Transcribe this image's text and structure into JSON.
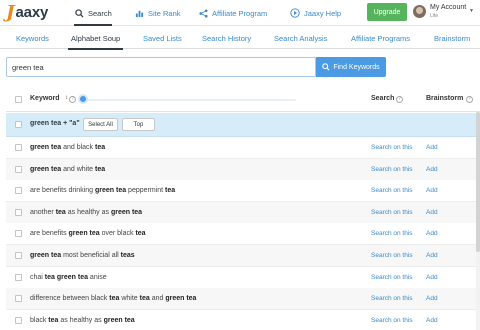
{
  "header": {
    "logo_letter": "J",
    "logo_rest": "aaxy",
    "nav": [
      {
        "label": "Search",
        "icon": "search-icon"
      },
      {
        "label": "Site Rank",
        "icon": "bar-chart-icon"
      },
      {
        "label": "Affiliate Program",
        "icon": "share-icon"
      },
      {
        "label": "Jaaxy Help",
        "icon": "play-icon"
      }
    ],
    "upgrade_label": "Upgrade",
    "account_label": "My Account",
    "account_sub": "Lite"
  },
  "tabs": [
    "Keywords",
    "Alphabet Soup",
    "Saved Lists",
    "Search History",
    "Search Analysis",
    "Affiliate Programs",
    "Brainstorm"
  ],
  "active_tab": "Alphabet Soup",
  "search": {
    "value": "green tea",
    "button_label": "Find Keywords"
  },
  "table": {
    "col_keyword": "Keyword",
    "sort_indicator": "↕",
    "col_search": "Search",
    "col_brainstorm": "Brainstorm",
    "slider_value_label": "a",
    "seed_row": {
      "text": "green tea + \"a\"",
      "select_all_label": "Select All",
      "top_label": "Top"
    },
    "action_search": "Search on this",
    "action_add": "Add",
    "rows": [
      [
        {
          "t": "green tea",
          "b": true
        },
        {
          "t": " and black ",
          "b": false
        },
        {
          "t": "tea",
          "b": true
        }
      ],
      [
        {
          "t": "green tea",
          "b": true
        },
        {
          "t": " and white ",
          "b": false
        },
        {
          "t": "tea",
          "b": true
        }
      ],
      [
        {
          "t": "are benefits drinking ",
          "b": false
        },
        {
          "t": "green tea",
          "b": true
        },
        {
          "t": " peppermint ",
          "b": false
        },
        {
          "t": "tea",
          "b": true
        }
      ],
      [
        {
          "t": "another ",
          "b": false
        },
        {
          "t": "tea",
          "b": true
        },
        {
          "t": " as healthy as ",
          "b": false
        },
        {
          "t": "green tea",
          "b": true
        }
      ],
      [
        {
          "t": "are benefits ",
          "b": false
        },
        {
          "t": "green tea",
          "b": true
        },
        {
          "t": " over black ",
          "b": false
        },
        {
          "t": "tea",
          "b": true
        }
      ],
      [
        {
          "t": "green tea",
          "b": true
        },
        {
          "t": " most beneficial all ",
          "b": false
        },
        {
          "t": "teas",
          "b": true
        }
      ],
      [
        {
          "t": "chai ",
          "b": false
        },
        {
          "t": "tea green tea",
          "b": true
        },
        {
          "t": " anise",
          "b": false
        }
      ],
      [
        {
          "t": "difference between black ",
          "b": false
        },
        {
          "t": "tea",
          "b": true
        },
        {
          "t": " white ",
          "b": false
        },
        {
          "t": "tea",
          "b": true
        },
        {
          "t": " and ",
          "b": false
        },
        {
          "t": "green tea",
          "b": true
        }
      ],
      [
        {
          "t": "black ",
          "b": false
        },
        {
          "t": "tea",
          "b": true
        },
        {
          "t": " as healthy as ",
          "b": false
        },
        {
          "t": "green tea",
          "b": true
        }
      ]
    ]
  },
  "colors": {
    "accent": "#4a9be3",
    "link": "#3a8ac9",
    "upgrade": "#56b45d",
    "seed_row_bg": "#d7ecf9",
    "logo_orange": "#e8891f"
  }
}
